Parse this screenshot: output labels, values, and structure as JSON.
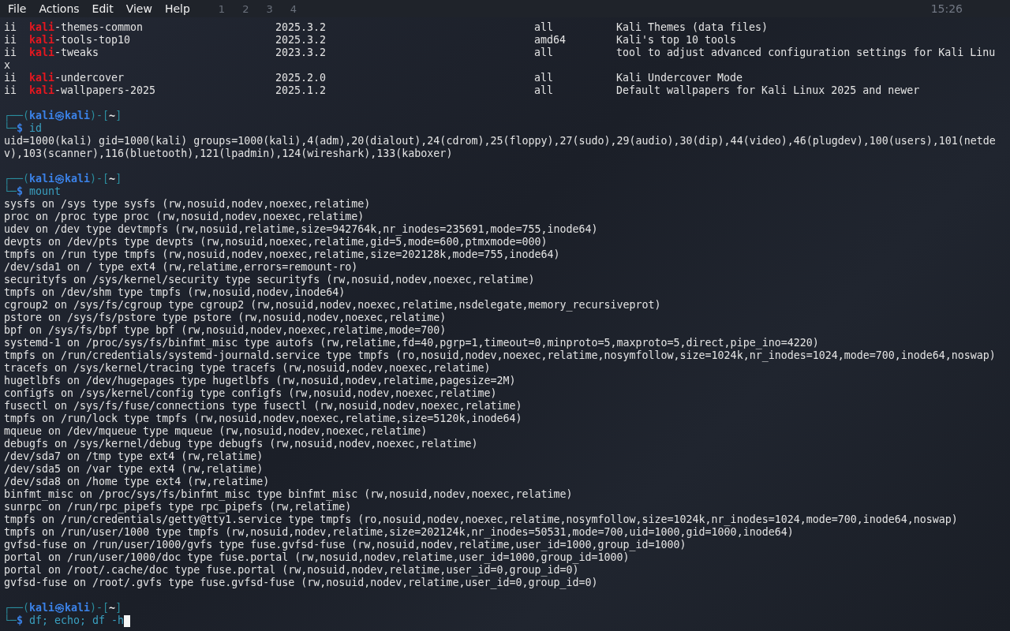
{
  "menu_bar": {
    "items": [
      "File",
      "Actions",
      "Edit",
      "View",
      "Help"
    ],
    "workspaces": [
      "1",
      "2",
      "3",
      "4"
    ],
    "clock": "15:26"
  },
  "package_rows": [
    {
      "status": "ii",
      "name_highlight": "kali",
      "name_rest": "-themes-common",
      "version": "2025.3.2",
      "architecture": "all",
      "description": "Kali Themes (data files)"
    },
    {
      "status": "ii",
      "name_highlight": "kali",
      "name_rest": "-tools-top10",
      "version": "2025.3.2",
      "architecture": "amd64",
      "description": "Kali's top 10 tools"
    },
    {
      "status": "ii",
      "name_highlight": "kali",
      "name_rest": "-tweaks",
      "version": "2023.3.2",
      "architecture": "all",
      "description": "tool to adjust advanced configuration settings for Kali Linu",
      "description_wrap": "x"
    },
    {
      "status": "ii",
      "name_highlight": "kali",
      "name_rest": "-undercover",
      "version": "2025.2.0",
      "architecture": "all",
      "description": "Kali Undercover Mode"
    },
    {
      "status": "ii",
      "name_highlight": "kali",
      "name_rest": "-wallpapers-2025",
      "version": "2025.1.2",
      "architecture": "all",
      "description": "Default wallpapers for Kali Linux 2025 and newer"
    }
  ],
  "sessions": [
    {
      "frame_open": "┌──(",
      "user": "kali",
      "at": "㉿",
      "host": "kali",
      "frame_mid": ")-[",
      "path": "~",
      "frame_close": "]",
      "corner": "└─",
      "symbol": "$",
      "command": "id",
      "cursor": false,
      "output": [
        "uid=1000(kali) gid=1000(kali) groups=1000(kali),4(adm),20(dialout),24(cdrom),25(floppy),27(sudo),29(audio),30(dip),44(video),46(plugdev),100(users),101(netde",
        "v),103(scanner),116(bluetooth),121(lpadmin),124(wireshark),133(kaboxer)"
      ]
    },
    {
      "frame_open": "┌──(",
      "user": "kali",
      "at": "㉿",
      "host": "kali",
      "frame_mid": ")-[",
      "path": "~",
      "frame_close": "]",
      "corner": "└─",
      "symbol": "$",
      "command": "mount",
      "cursor": false,
      "output": [
        "sysfs on /sys type sysfs (rw,nosuid,nodev,noexec,relatime)",
        "proc on /proc type proc (rw,nosuid,nodev,noexec,relatime)",
        "udev on /dev type devtmpfs (rw,nosuid,relatime,size=942764k,nr_inodes=235691,mode=755,inode64)",
        "devpts on /dev/pts type devpts (rw,nosuid,noexec,relatime,gid=5,mode=600,ptmxmode=000)",
        "tmpfs on /run type tmpfs (rw,nosuid,nodev,noexec,relatime,size=202128k,mode=755,inode64)",
        "/dev/sda1 on / type ext4 (rw,relatime,errors=remount-ro)",
        "securityfs on /sys/kernel/security type securityfs (rw,nosuid,nodev,noexec,relatime)",
        "tmpfs on /dev/shm type tmpfs (rw,nosuid,nodev,inode64)",
        "cgroup2 on /sys/fs/cgroup type cgroup2 (rw,nosuid,nodev,noexec,relatime,nsdelegate,memory_recursiveprot)",
        "pstore on /sys/fs/pstore type pstore (rw,nosuid,nodev,noexec,relatime)",
        "bpf on /sys/fs/bpf type bpf (rw,nosuid,nodev,noexec,relatime,mode=700)",
        "systemd-1 on /proc/sys/fs/binfmt_misc type autofs (rw,relatime,fd=40,pgrp=1,timeout=0,minproto=5,maxproto=5,direct,pipe_ino=4220)",
        "tmpfs on /run/credentials/systemd-journald.service type tmpfs (ro,nosuid,nodev,noexec,relatime,nosymfollow,size=1024k,nr_inodes=1024,mode=700,inode64,noswap)",
        "tracefs on /sys/kernel/tracing type tracefs (rw,nosuid,nodev,noexec,relatime)",
        "hugetlbfs on /dev/hugepages type hugetlbfs (rw,nosuid,nodev,relatime,pagesize=2M)",
        "configfs on /sys/kernel/config type configfs (rw,nosuid,nodev,noexec,relatime)",
        "fusectl on /sys/fs/fuse/connections type fusectl (rw,nosuid,nodev,noexec,relatime)",
        "tmpfs on /run/lock type tmpfs (rw,nosuid,nodev,noexec,relatime,size=5120k,inode64)",
        "mqueue on /dev/mqueue type mqueue (rw,nosuid,nodev,noexec,relatime)",
        "debugfs on /sys/kernel/debug type debugfs (rw,nosuid,nodev,noexec,relatime)",
        "/dev/sda7 on /tmp type ext4 (rw,relatime)",
        "/dev/sda5 on /var type ext4 (rw,relatime)",
        "/dev/sda8 on /home type ext4 (rw,relatime)",
        "binfmt_misc on /proc/sys/fs/binfmt_misc type binfmt_misc (rw,nosuid,nodev,noexec,relatime)",
        "sunrpc on /run/rpc_pipefs type rpc_pipefs (rw,relatime)",
        "tmpfs on /run/credentials/getty@tty1.service type tmpfs (ro,nosuid,nodev,noexec,relatime,nosymfollow,size=1024k,nr_inodes=1024,mode=700,inode64,noswap)",
        "tmpfs on /run/user/1000 type tmpfs (rw,nosuid,nodev,relatime,size=202124k,nr_inodes=50531,mode=700,uid=1000,gid=1000,inode64)",
        "gvfsd-fuse on /run/user/1000/gvfs type fuse.gvfsd-fuse (rw,nosuid,nodev,relatime,user_id=1000,group_id=1000)",
        "portal on /run/user/1000/doc type fuse.portal (rw,nosuid,nodev,relatime,user_id=1000,group_id=1000)",
        "portal on /root/.cache/doc type fuse.portal (rw,nosuid,nodev,relatime,user_id=0,group_id=0)",
        "gvfsd-fuse on /root/.gvfs type fuse.gvfsd-fuse (rw,nosuid,nodev,relatime,user_id=0,group_id=0)"
      ]
    },
    {
      "frame_open": "┌──(",
      "user": "kali",
      "at": "㉿",
      "host": "kali",
      "frame_mid": ")-[",
      "path": "~",
      "frame_close": "]",
      "corner": "└─",
      "symbol": "$",
      "command": "df; echo; df -h",
      "cursor": true
    }
  ]
}
